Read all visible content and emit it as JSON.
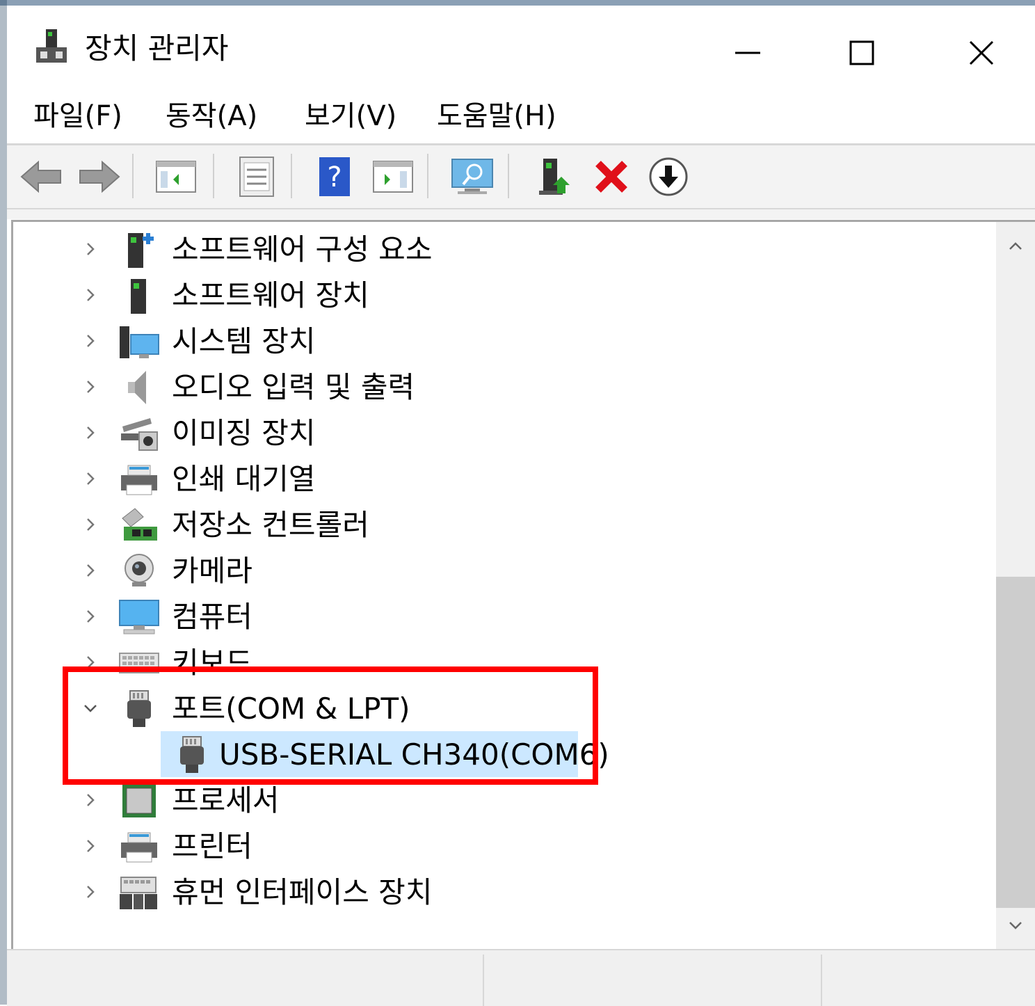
{
  "window": {
    "title": "장치 관리자"
  },
  "menu": [
    {
      "label": "파일(F)"
    },
    {
      "label": "동작(A)"
    },
    {
      "label": "보기(V)"
    },
    {
      "label": "도움말(H)"
    }
  ],
  "toolbar": {
    "buttons": [
      "back-arrow-icon",
      "forward-arrow-icon",
      "show-hide-console-tree-icon",
      "properties-icon",
      "help-icon",
      "action-pane-icon",
      "scan-hardware-icon",
      "update-driver-icon",
      "uninstall-device-icon",
      "download-icon"
    ]
  },
  "tree": {
    "items": [
      {
        "label": "소프트웨어 구성 요소",
        "icon": "software-component-icon"
      },
      {
        "label": "소프트웨어 장치",
        "icon": "software-device-icon"
      },
      {
        "label": "시스템 장치",
        "icon": "system-device-icon"
      },
      {
        "label": "오디오 입력 및 출력",
        "icon": "speaker-icon"
      },
      {
        "label": "이미징 장치",
        "icon": "imaging-device-icon"
      },
      {
        "label": "인쇄 대기열",
        "icon": "print-queue-icon"
      },
      {
        "label": "저장소 컨트롤러",
        "icon": "storage-controller-icon"
      },
      {
        "label": "카메라",
        "icon": "webcam-icon"
      },
      {
        "label": "컴퓨터",
        "icon": "monitor-icon"
      },
      {
        "label": "키보드",
        "icon": "keyboard-icon"
      },
      {
        "label": "포트(COM & LPT)",
        "icon": "port-connector-icon",
        "expanded": true
      },
      {
        "label": "USB-SERIAL CH340(COM6)",
        "icon": "port-connector-icon",
        "child": true,
        "selected": true
      },
      {
        "label": "프로세서",
        "icon": "processor-chip-icon"
      },
      {
        "label": "프린터",
        "icon": "printer-icon"
      },
      {
        "label": "휴먼 인터페이스 장치",
        "icon": "hid-device-icon"
      }
    ]
  },
  "colors": {
    "selection": "#cce8ff",
    "highlight_box": "#ff0000"
  }
}
